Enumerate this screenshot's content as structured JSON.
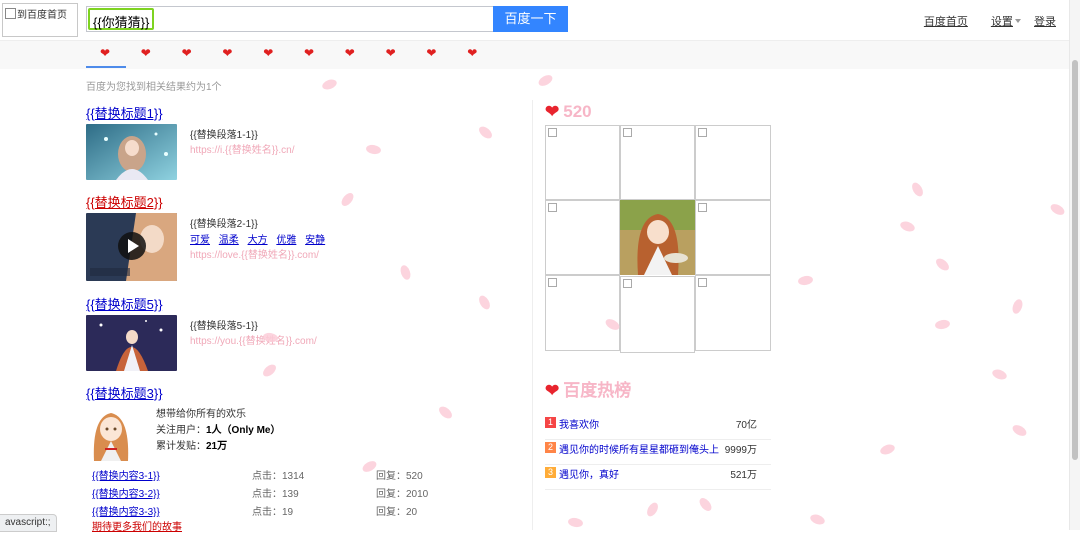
{
  "header": {
    "logo_alt": "到百度首页",
    "search_value": "{{你猜猜}}",
    "search_button": "百度一下",
    "links": {
      "home": "百度首页",
      "settings": "设置",
      "login": "登录"
    }
  },
  "tabs": {
    "icon": "heart-icon",
    "count": 10,
    "glyph": "❤"
  },
  "results": {
    "count_text": "百度为您找到相关结果约为1个",
    "items": [
      {
        "title": "{{替换标题1}}",
        "paragraph": "{{替换段落1-1}}",
        "url": "https://i.{{替换姓名}}.cn/"
      },
      {
        "title": "{{替换标题2}}",
        "paragraph": "{{替换段落2-1}}",
        "url": "https://love.{{替换姓名}}.com/",
        "tags": [
          "可爱",
          "温柔",
          "大方",
          "优雅",
          "安静"
        ]
      },
      {
        "title": "{{替换标题5}}",
        "paragraph": "{{替换段落5-1}}",
        "url": "https://you.{{替换姓名}}.com/"
      }
    ],
    "forum": {
      "title": "{{替换标题3}}",
      "desc": "想带给你所有的欢乐",
      "followers_label": "关注用户：",
      "followers_value": "1人（Only Me）",
      "posts_label": "累计发贴：",
      "posts_value": "21万",
      "rows": [
        {
          "title": "{{替换内容3-1}}",
          "clicks": "点击：1314",
          "replies": "回复：520"
        },
        {
          "title": "{{替换内容3-2}}",
          "clicks": "点击：139",
          "replies": "回复：2010"
        },
        {
          "title": "{{替换内容3-3}}",
          "clicks": "点击：19",
          "replies": "回复：20"
        }
      ],
      "more": "期待更多我们的故事"
    }
  },
  "status_bar": "avascript:;",
  "sidebar": {
    "title_520": "520",
    "hot_title": "百度热榜",
    "hot_list": [
      {
        "rank": "1",
        "text": "我喜欢你",
        "value": "70亿",
        "color": "#f54545"
      },
      {
        "rank": "2",
        "text": "遇见你的时候所有星星都砸到俺头上",
        "value": "9999万",
        "color": "#ff8547"
      },
      {
        "rank": "3",
        "text": "遇见你，真好",
        "value": "521万",
        "color": "#ffac38"
      }
    ]
  },
  "colors": {
    "accent": "#3385ff",
    "highlight": "#7ed321",
    "petal": "#fbcdd8",
    "sidebar_title": "#f7b6c7"
  }
}
